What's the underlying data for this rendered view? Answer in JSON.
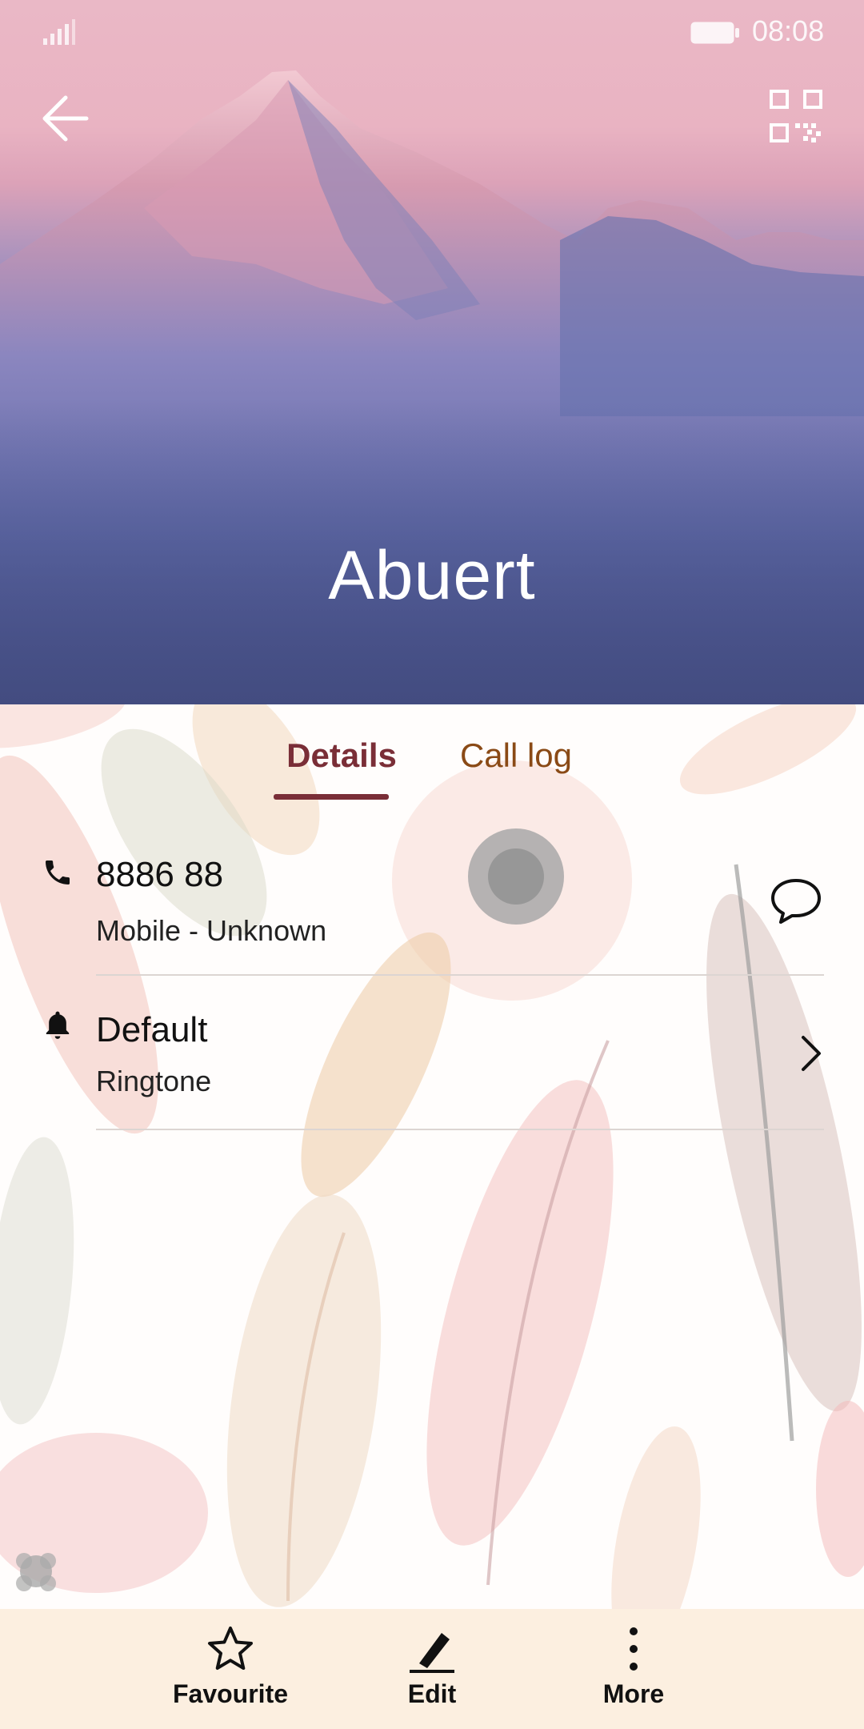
{
  "status_bar": {
    "time": "08:08"
  },
  "contact": {
    "name": "Abuert"
  },
  "tabs": [
    {
      "label": "Details",
      "active": true
    },
    {
      "label": "Call log",
      "active": false
    }
  ],
  "phone": {
    "number": "8886 88",
    "type": "Mobile - Unknown"
  },
  "ringtone": {
    "value": "Default",
    "label": "Ringtone"
  },
  "actions": [
    {
      "label": "Favourite",
      "icon": "star-icon"
    },
    {
      "label": "Edit",
      "icon": "pencil-icon"
    },
    {
      "label": "More",
      "icon": "more-vertical-icon"
    }
  ],
  "colors": {
    "accent": "#7a2e37",
    "secondary_tab": "#8a4a16",
    "bottom_bar": "#fcefe0"
  }
}
